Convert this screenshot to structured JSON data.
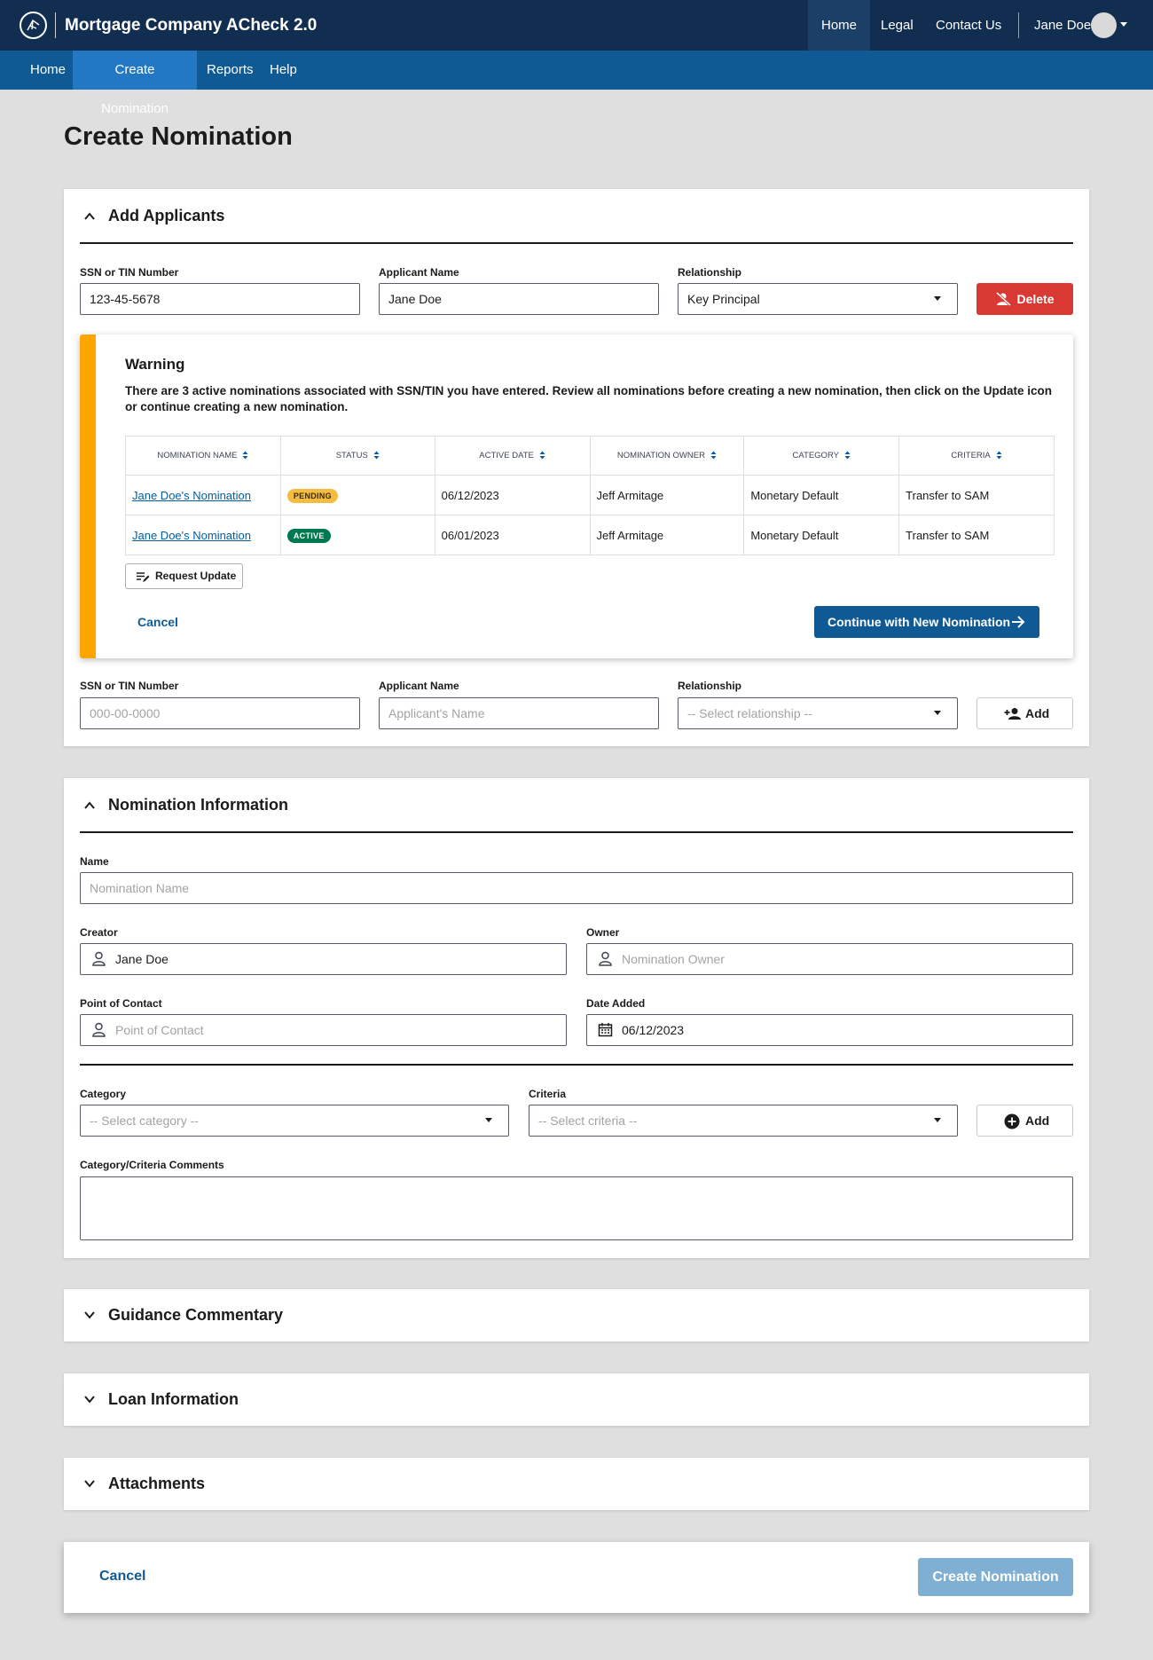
{
  "header": {
    "app_title": "Mortgage Company ACheck 2.0",
    "nav": [
      "Home",
      "Legal",
      "Contact Us"
    ],
    "user_name": "Jane Doe"
  },
  "subnav": [
    "Home",
    "Create Nomination",
    "Reports",
    "Help"
  ],
  "page_title": "Create Nomination",
  "applicants": {
    "title": "Add Applicants",
    "labels": {
      "ssn": "SSN or TIN Number",
      "name": "Applicant Name",
      "relationship": "Relationship"
    },
    "row1": {
      "ssn": "123-45-5678",
      "name": "Jane Doe",
      "relationship": "Key Principal",
      "delete_label": "Delete"
    },
    "warning": {
      "title": "Warning",
      "message": "There are 3 active nominations associated with SSN/TIN you have entered. Review all nominations before creating a new nomination, then click on the Update icon or continue creating a new nomination.",
      "columns": [
        "NOMINATION NAME",
        "STATUS",
        "ACTIVE DATE",
        "NOMINATION OWNER",
        "CATEGORY",
        "CRITERIA"
      ],
      "rows": [
        {
          "name": "Jane Doe's Nomination",
          "status": "PENDING",
          "date": "06/12/2023",
          "owner": "Jeff Armitage",
          "category": "Monetary Default",
          "criteria": "Transfer to SAM"
        },
        {
          "name": "Jane Doe's Nomination",
          "status": "ACTIVE",
          "date": "06/01/2023",
          "owner": "Jeff Armitage",
          "category": "Monetary Default",
          "criteria": "Transfer to SAM"
        }
      ],
      "request_update": "Request Update",
      "cancel": "Cancel",
      "continue": "Continue with New Nomination"
    },
    "row2": {
      "ssn_placeholder": "000-00-0000",
      "name_placeholder": "Applicant's Name",
      "relationship_placeholder": "-- Select relationship --",
      "add_label": "Add"
    }
  },
  "nomination": {
    "title": "Nomination Information",
    "labels": {
      "name": "Name",
      "creator": "Creator",
      "owner": "Owner",
      "poc": "Point of Contact",
      "date_added": "Date Added",
      "category": "Category",
      "criteria": "Criteria",
      "comments": "Category/Criteria Comments"
    },
    "name_placeholder": "Nomination Name",
    "creator": "Jane Doe",
    "owner_placeholder": "Nomination Owner",
    "poc_placeholder": "Point of Contact",
    "date_added": "06/12/2023",
    "category_placeholder": "-- Select category --",
    "criteria_placeholder": "-- Select criteria --",
    "add_label": "Add"
  },
  "sections": [
    "Guidance Commentary",
    "Loan Information",
    "Attachments"
  ],
  "footer": {
    "cancel": "Cancel",
    "create": "Create Nomination"
  }
}
